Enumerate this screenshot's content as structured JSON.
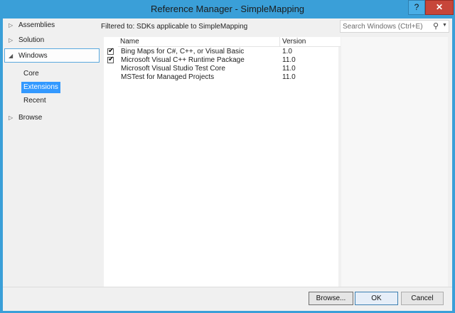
{
  "window": {
    "title": "Reference Manager - SimpleMapping",
    "help_label": "?",
    "close_label": "✕"
  },
  "sidebar": {
    "nodes": [
      {
        "label": "Assemblies",
        "arrow": "▷"
      },
      {
        "label": "Solution",
        "arrow": "▷"
      },
      {
        "label": "Windows",
        "arrow": "◢"
      },
      {
        "label": "Browse",
        "arrow": "▷"
      }
    ],
    "windows_children": [
      "Core",
      "Extensions",
      "Recent"
    ],
    "selected_child": "Extensions"
  },
  "main": {
    "filter_text": "Filtered to: SDKs applicable to SimpleMapping",
    "search_placeholder": "Search Windows (Ctrl+E)",
    "columns": {
      "name": "Name",
      "version": "Version"
    },
    "rows": [
      {
        "checked": true,
        "name": "Bing Maps for C#, C++, or Visual Basic",
        "version": "1.0"
      },
      {
        "checked": true,
        "name": "Microsoft Visual C++ Runtime Package",
        "version": "11.0"
      },
      {
        "checked": false,
        "name": "Microsoft Visual Studio Test Core",
        "version": "11.0"
      },
      {
        "checked": false,
        "name": "MSTest for Managed Projects",
        "version": "11.0"
      }
    ]
  },
  "footer": {
    "browse_label": "Browse...",
    "ok_label": "OK",
    "cancel_label": "Cancel"
  },
  "icons": {
    "search": "magnifier-icon",
    "dropdown": "chevron-down-icon",
    "check": "checkmark-icon"
  },
  "colors": {
    "titlebar": "#3a9fd8",
    "selection": "#3399ff",
    "close": "#c7463a"
  }
}
